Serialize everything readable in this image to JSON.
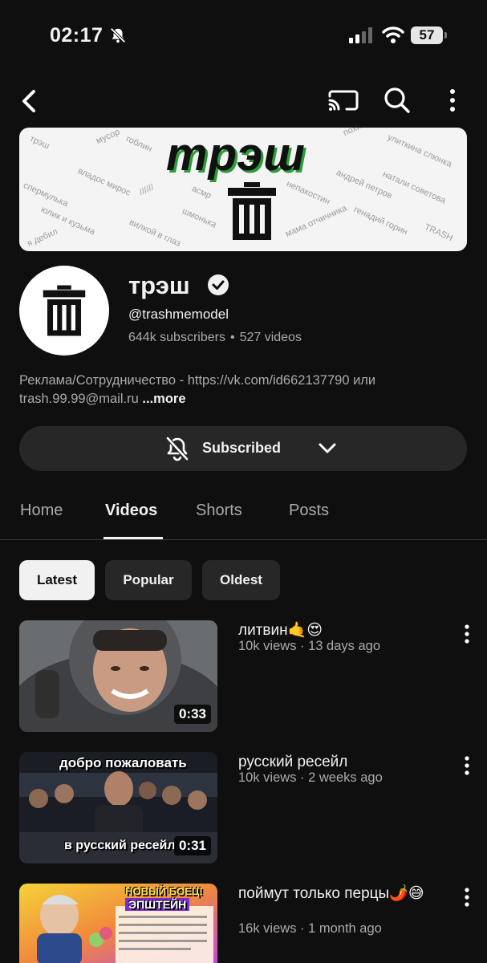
{
  "status_bar": {
    "time": "02:17",
    "battery": "57"
  },
  "banner": {
    "title": "трэш",
    "words": [
      "трэш",
      "мусор",
      "гоблин",
      "похитюша",
      "улиткина слюнка",
      "спермулька",
      "владос мирос",
      "//////",
      "натали советова",
      "андрей петров",
      "асмр",
      "непакостин",
      "юлик и кузьма",
      "шмонька",
      "мама отчичника",
      "генадий горин",
      "я дебил",
      "вилкой в глаз",
      "TRASH"
    ]
  },
  "channel": {
    "name": "трэш",
    "handle": "@trashmemodel",
    "subscribers": "644k subscribers",
    "videos_count": "527 videos",
    "separator": "•",
    "description_line1": "Реклама/Сотрудничество - https://vk.com/id662137790 или",
    "description_line2": "trash.99.99@mail.ru",
    "more_label": "...more"
  },
  "subscribe": {
    "label": "Subscribed"
  },
  "tabs": [
    {
      "label": "Home"
    },
    {
      "label": "Videos",
      "active": true
    },
    {
      "label": "Shorts"
    },
    {
      "label": "Posts"
    }
  ],
  "chips": [
    {
      "label": "Latest",
      "selected": true
    },
    {
      "label": "Popular"
    },
    {
      "label": "Oldest"
    }
  ],
  "videos": [
    {
      "title": "литвин🤙😍",
      "meta": "10k views · 13 days ago",
      "duration": "0:33"
    },
    {
      "title": "русский ресейл",
      "meta": "10k views · 2 weeks ago",
      "duration": "0:31",
      "thumb_top": "добро пожаловать",
      "thumb_bottom": "в русский ресейл"
    },
    {
      "title": "поймут только перцы🌶️😅",
      "meta": "16k views · 1 month ago",
      "thumb_badge": "НОВЫЙ БОЕЦ!",
      "thumb_name": "ЭПШТЕЙН"
    }
  ],
  "colors": {
    "background": "#0f0f0f",
    "surface": "#272727",
    "text": "#f1f1f1",
    "secondary": "#aaaaaa"
  }
}
